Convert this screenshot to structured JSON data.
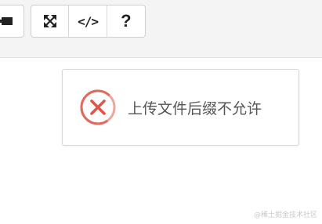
{
  "toolbar": {
    "buttons": [
      {
        "icon": "fullscreen-icon"
      },
      {
        "icon": "code-icon",
        "label": "</>"
      },
      {
        "icon": "help-icon",
        "label": "?"
      }
    ]
  },
  "toast": {
    "icon": "error-circle-x-icon",
    "message": "上传文件后缀不允许",
    "accent_color": "#e06a5b"
  },
  "watermark": {
    "text": "@稀土掘金技术社区"
  }
}
